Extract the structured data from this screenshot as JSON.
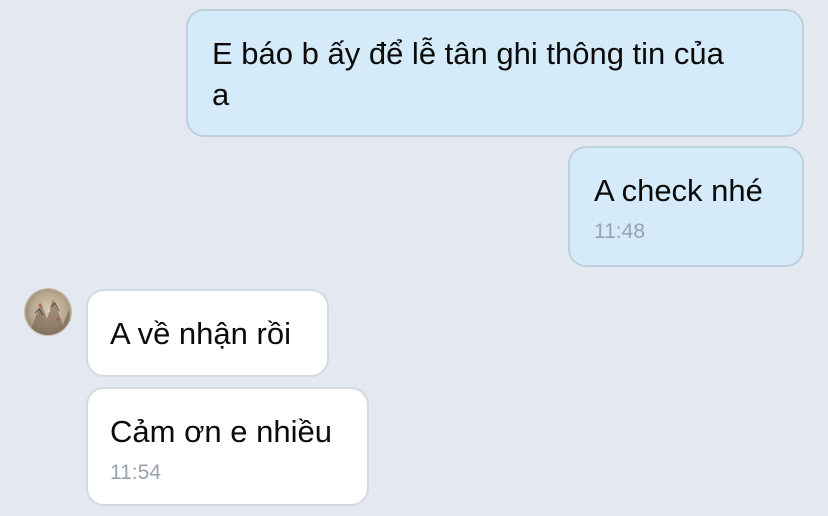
{
  "conversation": {
    "messages": [
      {
        "direction": "sent",
        "text": "E báo b ấy để lễ tân ghi thông tin của\na",
        "time": ""
      },
      {
        "direction": "sent",
        "text": "A check nhé",
        "time": "11:48"
      },
      {
        "direction": "received",
        "text": "A về nhận rồi",
        "time": ""
      },
      {
        "direction": "received",
        "text": "Cảm ơn e nhiều",
        "time": "11:54"
      }
    ],
    "contact": {
      "avatar_icon": "contact-avatar-icon"
    }
  },
  "colors": {
    "background": "#e4e8f1",
    "sent_bubble": "#d6ebfa",
    "received_bubble": "#ffffff",
    "timestamp": "#9aa2ad"
  }
}
